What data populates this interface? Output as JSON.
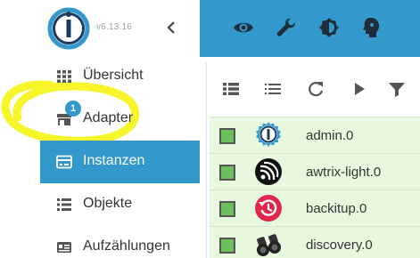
{
  "sidebar": {
    "version": "v6.13.16",
    "items": [
      {
        "label": "Übersicht",
        "icon": "grid-icon"
      },
      {
        "label": "Adapter",
        "icon": "store-icon",
        "badge": "1"
      },
      {
        "label": "Instanzen",
        "icon": "instances-icon",
        "active": true
      },
      {
        "label": "Objekte",
        "icon": "list-icon"
      },
      {
        "label": "Aufzählungen",
        "icon": "enum-icon"
      }
    ]
  },
  "topbar": {
    "icons": [
      "eye-icon",
      "wrench-icon",
      "brightness-icon",
      "head-icon"
    ]
  },
  "toolbar": {
    "icons": [
      "view-grid-icon",
      "view-list-icon",
      "reload-icon",
      "play-icon",
      "filter-icon"
    ]
  },
  "instances": [
    {
      "name": "admin.0",
      "icon": "iobroker-icon"
    },
    {
      "name": "awtrix-light.0",
      "icon": "espressif-icon"
    },
    {
      "name": "backitup.0",
      "icon": "backup-icon"
    },
    {
      "name": "discovery.0",
      "icon": "binoculars-icon"
    }
  ],
  "colors": {
    "accent": "#3399cc",
    "row_background": "#e8f8df",
    "checkbox": "#6cbf5a",
    "highlight": "#f5f51f"
  }
}
